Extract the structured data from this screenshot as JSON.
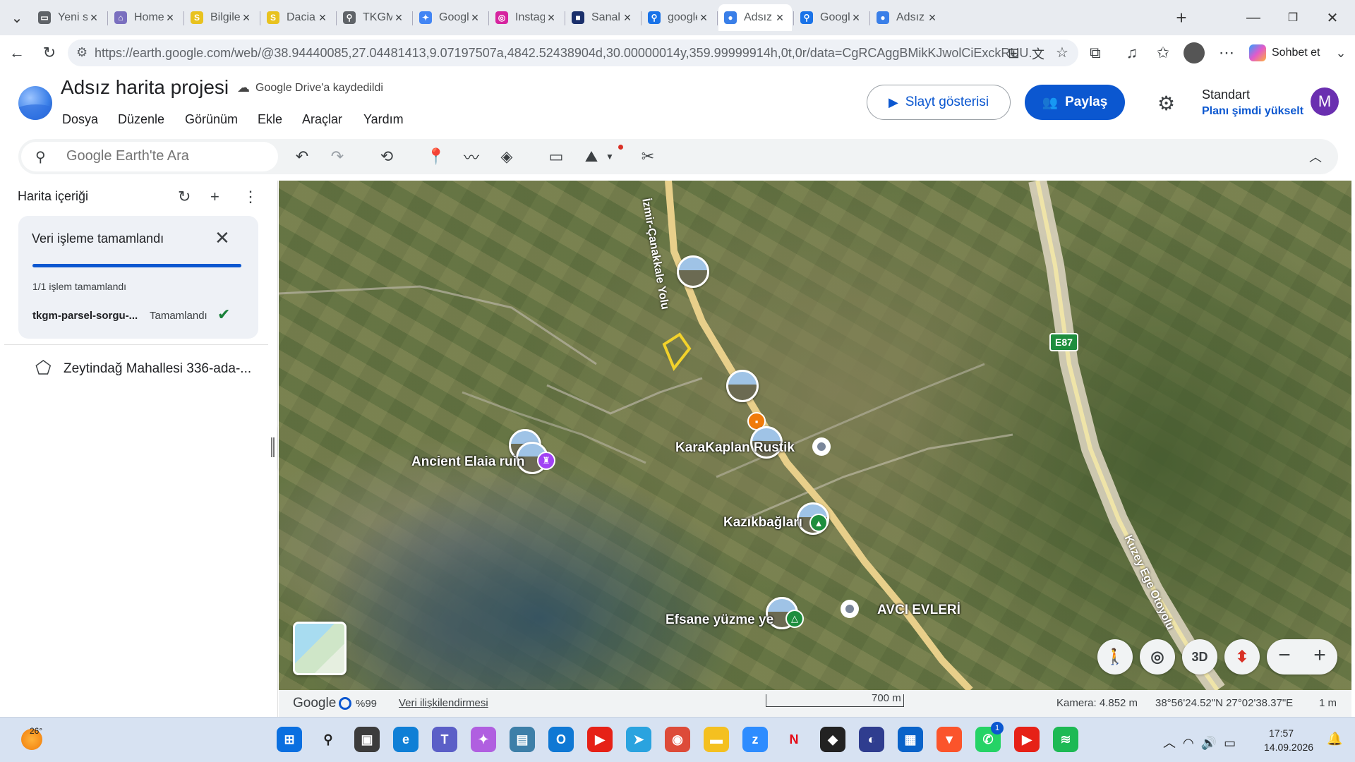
{
  "browser": {
    "tabs": [
      {
        "label": "Yeni sekme",
        "color": "#5f6368",
        "glyph": "▭"
      },
      {
        "label": "Home Page",
        "color": "#7a6fbf",
        "glyph": "⌂"
      },
      {
        "label": "Bilgilendirme",
        "color": "#e8c21f",
        "glyph": "S"
      },
      {
        "label": "Dacia / D",
        "color": "#e8c21f",
        "glyph": "S"
      },
      {
        "label": "TKGM | P",
        "color": "#5f6368",
        "glyph": "⚲"
      },
      {
        "label": "Google G",
        "color": "#4285f4",
        "glyph": "✦"
      },
      {
        "label": "Instagram",
        "color": "#d6249f",
        "glyph": "◎"
      },
      {
        "label": "Sanal Dr",
        "color": "#1a2f6b",
        "glyph": "■"
      },
      {
        "label": "google e",
        "color": "#1a73e8",
        "glyph": "⚲"
      },
      {
        "label": "Adsız har",
        "color": "#3a7fe8",
        "glyph": "●"
      },
      {
        "label": "Google E",
        "color": "#1a73e8",
        "glyph": "⚲"
      },
      {
        "label": "Adsız har",
        "color": "#3a7fe8",
        "glyph": "●"
      }
    ],
    "active_tab_index": 9,
    "new_tab": "+",
    "url": "https://earth.google.com/web/@38.94440085,27.04481413,9.07197507a,4842.52438904d,30.00000014y,359.99999914h,0t,0r/data=CgRCAggBMikKJwolCiExckRUU...",
    "copilot_label": "Sohbet et"
  },
  "project": {
    "title": "Adsız harita projesi",
    "saved_status": "Google Drive'a kaydedildi",
    "menu": [
      "Dosya",
      "Düzenle",
      "Görünüm",
      "Ekle",
      "Araçlar",
      "Yardım"
    ],
    "slideshow_label": "Slayt gösterisi",
    "share_label": "Paylaş",
    "plan_name": "Standart",
    "plan_upgrade": "Planı şimdi yükselt",
    "avatar_letter": "M"
  },
  "search": {
    "placeholder": "Google Earth'te Ara"
  },
  "sidebar": {
    "title": "Harita içeriği",
    "processing": {
      "title": "Veri işleme tamamlandı",
      "progress": 1.0,
      "count_text": "1/1 işlem tamamlandı",
      "job_name": "tkgm-parsel-sorgu-...",
      "job_status": "Tamamlandı"
    },
    "layer_name": "Zeytindağ Mahallesi 336-ada-..."
  },
  "map": {
    "places": [
      {
        "name": "Ancient Elaia ruin"
      },
      {
        "name": "KaraKaplan Rustik"
      },
      {
        "name": "Kazıkbağları"
      },
      {
        "name": "Efsane yüzme ye"
      },
      {
        "name": "AVCI EVLERİ"
      }
    ],
    "road_labels": {
      "izmir": "İzmir-Çanakkale Yolu",
      "kuzey": "Kuzey Ege Otoyolu",
      "shield": "E87"
    },
    "controls": {
      "three_d": "3D",
      "zoom_out": "−",
      "zoom_in": "+"
    }
  },
  "footer": {
    "google": "Google",
    "percent": "%99",
    "data_attribution": "Veri ilişkilendirmesi",
    "scale": "700 m",
    "camera": "Kamera: 4.852 m",
    "coords": "38°56'24.52\"N 27°02'38.37\"E",
    "altitude": "1 m"
  },
  "taskbar": {
    "temperature": "26°",
    "time": "17:57",
    "date": "14.09.2026",
    "whatsapp_badge": "1",
    "apps": [
      {
        "name": "start",
        "color": "#0a6fe0",
        "glyph": "⊞"
      },
      {
        "name": "search",
        "color": "#d7e2f2",
        "glyph": "⚲"
      },
      {
        "name": "taskview",
        "color": "#3c3c3c",
        "glyph": "▣"
      },
      {
        "name": "edge",
        "color": "#0f7fd6",
        "glyph": "e"
      },
      {
        "name": "teams",
        "color": "#5b5fc7",
        "glyph": "T"
      },
      {
        "name": "copilot",
        "color": "#b05fe0",
        "glyph": "✦"
      },
      {
        "name": "notepad",
        "color": "#3d7fa8",
        "glyph": "▤"
      },
      {
        "name": "outlook",
        "color": "#0f78d4",
        "glyph": "O"
      },
      {
        "name": "youtube",
        "color": "#e62117",
        "glyph": "▶"
      },
      {
        "name": "telegram",
        "color": "#2aa3df",
        "glyph": "➤"
      },
      {
        "name": "chrome",
        "color": "#dd4b39",
        "glyph": "◉"
      },
      {
        "name": "explorer",
        "color": "#f4c020",
        "glyph": "▬"
      },
      {
        "name": "zoom",
        "color": "#2d8cff",
        "glyph": "z"
      },
      {
        "name": "netflix",
        "color": "#d7e2f2",
        "glyph": "N"
      },
      {
        "name": "antivirus",
        "color": "#222222",
        "glyph": "◆"
      },
      {
        "name": "nordvpn",
        "color": "#2f3d8f",
        "glyph": "◐"
      },
      {
        "name": "store",
        "color": "#0a63c9",
        "glyph": "▦"
      },
      {
        "name": "brave",
        "color": "#fb542b",
        "glyph": "▼"
      },
      {
        "name": "whatsapp",
        "color": "#25d366",
        "glyph": "✆"
      },
      {
        "name": "youtube2",
        "color": "#e62117",
        "glyph": "▶"
      },
      {
        "name": "spotify",
        "color": "#1db954",
        "glyph": "≋"
      }
    ]
  }
}
